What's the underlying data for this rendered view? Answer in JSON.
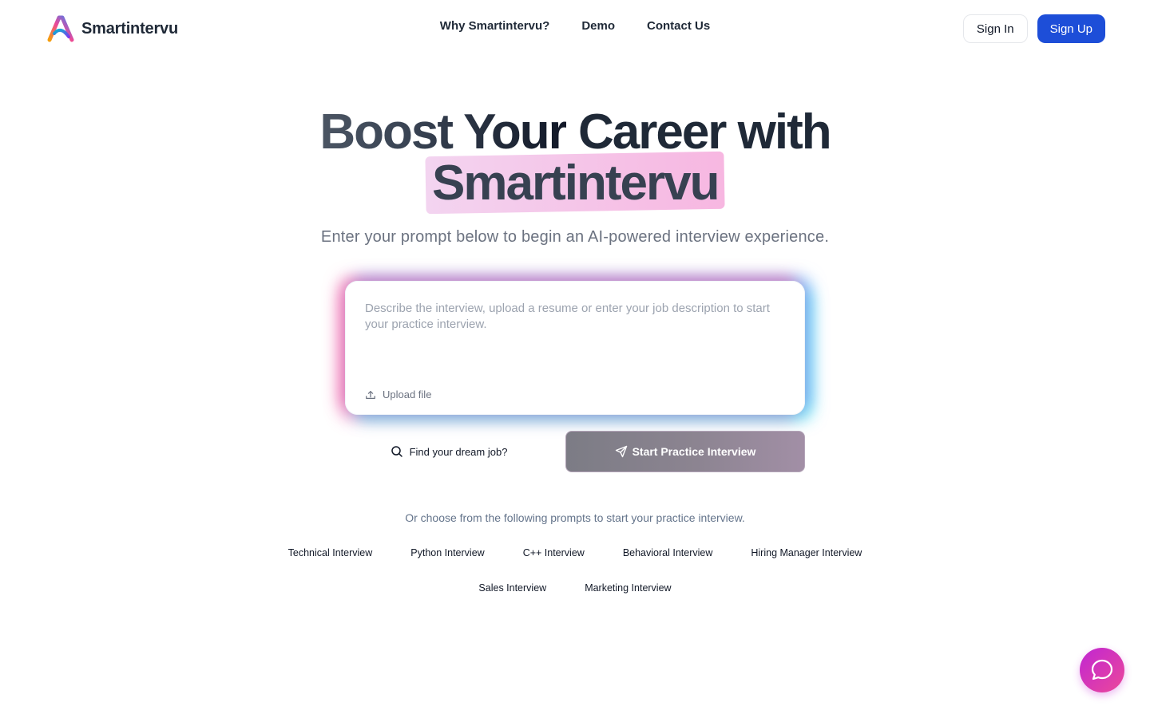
{
  "header": {
    "brand_name": "Smartintervu",
    "nav": [
      "Why Smartintervu?",
      "Demo",
      "Contact Us"
    ],
    "sign_in": "Sign In",
    "sign_up": "Sign Up"
  },
  "hero": {
    "title_line1_part1": "Boost Your",
    "title_line1_part2": " Career with",
    "title_line2": "Smartintervu",
    "subtitle": "Enter your prompt below to begin an AI-powered interview experience."
  },
  "prompt": {
    "placeholder": "Describe the interview, upload a resume or enter your job description to start your practice interview.",
    "value": "",
    "upload_label": "Upload file"
  },
  "actions": {
    "find_job": "Find your dream job?",
    "start": "Start Practice Interview"
  },
  "suggestions": {
    "intro": "Or choose from the following prompts to start your practice interview.",
    "row1": [
      "Technical Interview",
      "Python Interview",
      "C++ Interview",
      "Behavioral Interview",
      "Hiring Manager Interview"
    ],
    "row2": [
      "Sales Interview",
      "Marketing Interview"
    ]
  },
  "icons": {
    "logo": "smartintervu-logo-icon",
    "upload": "upload-icon",
    "search": "search-icon",
    "send": "send-icon",
    "chat": "chat-bubble-icon"
  },
  "colors": {
    "primary": "#1d4ed8",
    "highlight_start": "#f3d4f0",
    "highlight_end": "#f7b7e1",
    "chat_start": "#c026d3",
    "chat_end": "#ec4899"
  }
}
